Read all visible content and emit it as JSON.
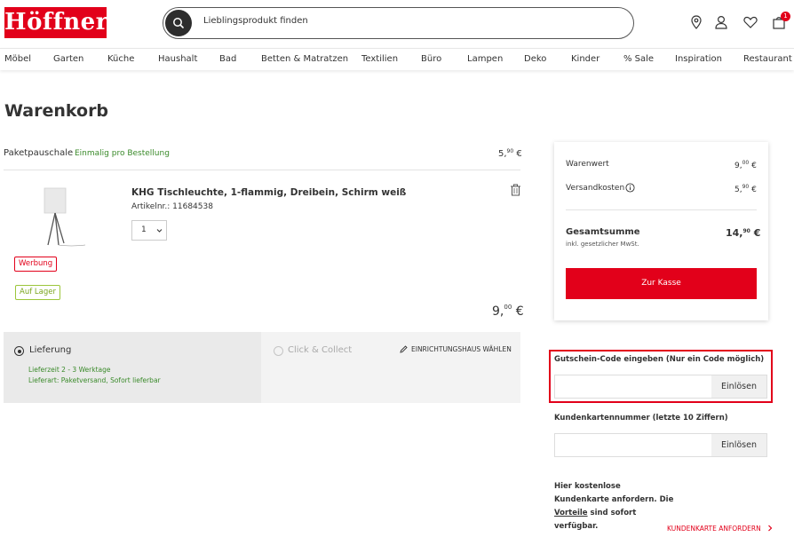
{
  "header": {
    "logo_text": "Höffner",
    "search_placeholder": "Lieblingsprodukt finden",
    "cart_count": "1",
    "icons": [
      "search-icon",
      "location-pin-icon",
      "user-icon",
      "heart-icon",
      "shopping-bag-icon"
    ]
  },
  "nav": {
    "items": [
      "Möbel",
      "Garten",
      "Küche",
      "Haushalt",
      "Bad",
      "Betten & Matratzen",
      "Textilien",
      "Büro",
      "Lampen",
      "Deko",
      "Kinder",
      "% Sale",
      "Inspiration",
      "Restaurant"
    ]
  },
  "page": {
    "title": "Warenkorb"
  },
  "cart": {
    "shipping_label": "Paketpauschale",
    "shipping_note": "Einmalig pro Bestellung",
    "shipping_price_main": "5,",
    "shipping_price_sup": "90",
    "currency": "€",
    "item": {
      "name": "KHG Tischleuchte, 1-flammig, Dreibein, Schirm weiß",
      "article_no": "Artikelnr.: 11684538",
      "qty": "1",
      "tag_ad": "Werbung",
      "tag_stock": "Auf Lager",
      "price_main": "9,",
      "price_sup": "00"
    },
    "delivery": {
      "option_delivery": "Lieferung",
      "delivery_time": "Lieferzeit 2 - 3 Werktage",
      "delivery_type": "Lieferart: Paketversand, Sofort lieferbar",
      "option_collect": "Click & Collect",
      "choose_store": "EINRICHTUNGSHAUS WÄHLEN"
    }
  },
  "summary": {
    "goods_label": "Warenwert",
    "goods_main": "9,",
    "goods_sup": "00",
    "shipping_label": "Versandkosten",
    "shipping_main": "5,",
    "shipping_sup": "90",
    "total_label": "Gesamtsumme",
    "total_note": "inkl. gesetzlicher MwSt.",
    "total_main": "14,",
    "total_sup": "90",
    "checkout_label": "Zur Kasse"
  },
  "coupon": {
    "label": "Gutschein-Code eingeben (Nur ein Code möglich)",
    "button": "Einlösen",
    "highlight_color": "#e2001a"
  },
  "customer_card": {
    "label": "Kundenkartennummer (letzte 10 Ziffern)",
    "button": "Einlösen",
    "promo_line1": "Hier kostenlose",
    "promo_line2": "Kundenkarte anfordern. Die",
    "promo_link": "Vorteile",
    "promo_line3": " sind sofort",
    "promo_line4": "verfügbar.",
    "request_link": "KUNDENKARTE ANFORDERN"
  },
  "colors": {
    "brand": "#e2001a",
    "green": "#3a8a2a",
    "sale": "#e2001a"
  }
}
